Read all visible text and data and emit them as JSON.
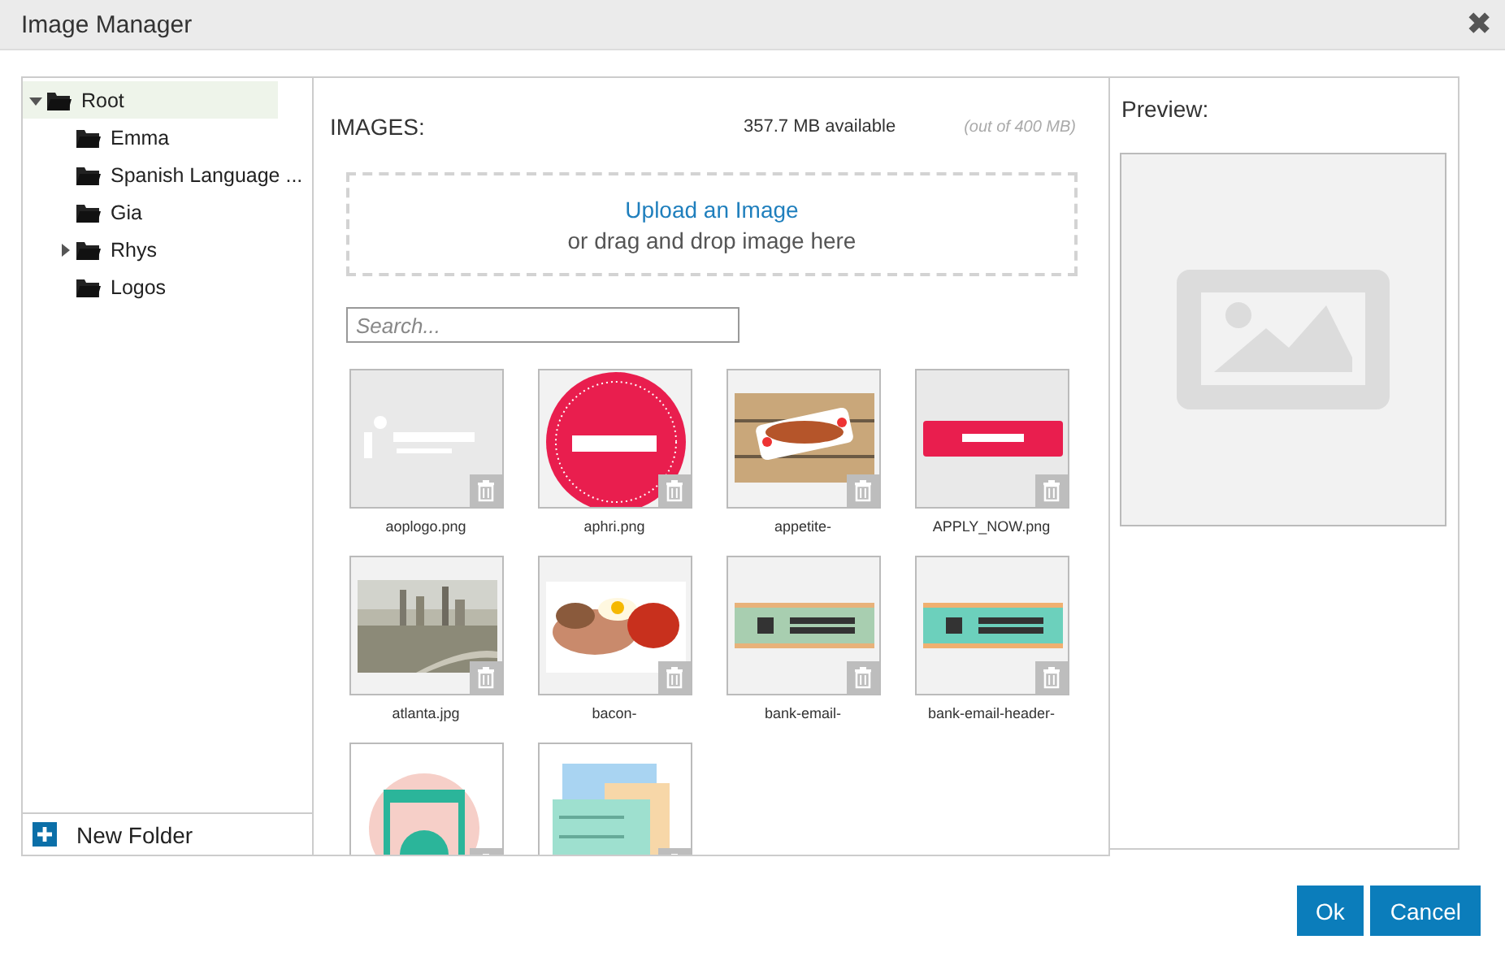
{
  "window": {
    "title": "Image Manager",
    "close": "✖"
  },
  "folders": [
    {
      "name": "Root",
      "selected": true,
      "expanded": true,
      "children": [
        {
          "name": "Emma",
          "selected": false
        },
        {
          "name": "Spanish Language ...",
          "selected": false
        },
        {
          "name": "Gia",
          "selected": false
        },
        {
          "name": "Rhys",
          "selected": false,
          "expanded": false
        },
        {
          "name": "Logos",
          "selected": false
        }
      ]
    }
  ],
  "new_folder": {
    "label": "New Folder"
  },
  "images": {
    "heading": "IMAGES:",
    "available": "357.7 MB available",
    "quota": "(out of 400 MB)",
    "upload_link": "Upload an Image",
    "upload_hint": "or drag and drop image here",
    "search": {
      "placeholder": "Search..."
    },
    "items": [
      {
        "name": "aoplogo.png",
        "kind": "picture"
      },
      {
        "name": "aphri.png",
        "kind": "picture"
      },
      {
        "name": "appetite-",
        "kind": "picture"
      },
      {
        "name": "APPLY_NOW.png",
        "kind": "picture"
      },
      {
        "name": "atlanta.jpg",
        "kind": "picture"
      },
      {
        "name": "bacon-",
        "kind": "picture"
      },
      {
        "name": "bank-email-",
        "kind": "picture"
      },
      {
        "name": "bank-email-header-",
        "kind": "picture"
      },
      {
        "kind": "picture"
      },
      {
        "kind": "picture"
      }
    ]
  },
  "preview": {
    "label": "Preview:"
  },
  "buttons": [
    {
      "label": "Ok"
    },
    {
      "label": "Cancel"
    }
  ]
}
